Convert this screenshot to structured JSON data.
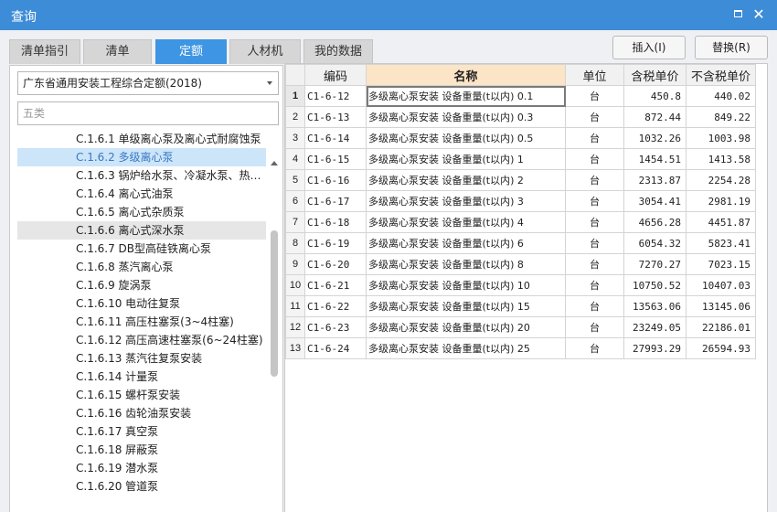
{
  "window": {
    "title": "查询"
  },
  "tabs": [
    {
      "label": "清单指引",
      "active": false
    },
    {
      "label": "清单",
      "active": false
    },
    {
      "label": "定额",
      "active": true
    },
    {
      "label": "人材机",
      "active": false
    },
    {
      "label": "我的数据",
      "active": false
    }
  ],
  "actions": {
    "insert_label": "插入(I)",
    "replace_label": "替换(R)"
  },
  "library": {
    "selected": "广东省通用安装工程综合定额(2018)"
  },
  "search": {
    "value": "五类"
  },
  "tree": {
    "items": [
      {
        "label": "C.1.6.1 单级离心泵及离心式耐腐蚀泵",
        "state": ""
      },
      {
        "label": "C.1.6.2 多级离心泵",
        "state": "selected"
      },
      {
        "label": "C.1.6.3 锅炉给水泵、冷凝水泵、热…",
        "state": ""
      },
      {
        "label": "C.1.6.4 离心式油泵",
        "state": ""
      },
      {
        "label": "C.1.6.5 离心式杂质泵",
        "state": ""
      },
      {
        "label": "C.1.6.6 离心式深水泵",
        "state": "hovered"
      },
      {
        "label": "C.1.6.7 DB型高硅铁离心泵",
        "state": ""
      },
      {
        "label": "C.1.6.8 蒸汽离心泵",
        "state": ""
      },
      {
        "label": "C.1.6.9 旋涡泵",
        "state": ""
      },
      {
        "label": "C.1.6.10 电动往复泵",
        "state": ""
      },
      {
        "label": "C.1.6.11 高压柱塞泵(3~4柱塞)",
        "state": ""
      },
      {
        "label": "C.1.6.12 高压高速柱塞泵(6~24柱塞)",
        "state": ""
      },
      {
        "label": "C.1.6.13 蒸汽往复泵安装",
        "state": ""
      },
      {
        "label": "C.1.6.14 计量泵",
        "state": ""
      },
      {
        "label": "C.1.6.15 螺杆泵安装",
        "state": ""
      },
      {
        "label": "C.1.6.16 齿轮油泵安装",
        "state": ""
      },
      {
        "label": "C.1.6.17 真空泵",
        "state": ""
      },
      {
        "label": "C.1.6.18 屏蔽泵",
        "state": ""
      },
      {
        "label": "C.1.6.19 潜水泵",
        "state": ""
      },
      {
        "label": "C.1.6.20 管道泵",
        "state": ""
      }
    ]
  },
  "grid": {
    "columns": [
      "编码",
      "名称",
      "单位",
      "含税单价",
      "不含税单价"
    ],
    "rows": [
      {
        "n": "1",
        "code": "C1-6-12",
        "name": "多级离心泵安装 设备重量(t以内) 0.1",
        "unit": "台",
        "tax": "450.8",
        "notax": "440.02"
      },
      {
        "n": "2",
        "code": "C1-6-13",
        "name": "多级离心泵安装 设备重量(t以内) 0.3",
        "unit": "台",
        "tax": "872.44",
        "notax": "849.22"
      },
      {
        "n": "3",
        "code": "C1-6-14",
        "name": "多级离心泵安装 设备重量(t以内) 0.5",
        "unit": "台",
        "tax": "1032.26",
        "notax": "1003.98"
      },
      {
        "n": "4",
        "code": "C1-6-15",
        "name": "多级离心泵安装 设备重量(t以内) 1",
        "unit": "台",
        "tax": "1454.51",
        "notax": "1413.58"
      },
      {
        "n": "5",
        "code": "C1-6-16",
        "name": "多级离心泵安装 设备重量(t以内) 2",
        "unit": "台",
        "tax": "2313.87",
        "notax": "2254.28"
      },
      {
        "n": "6",
        "code": "C1-6-17",
        "name": "多级离心泵安装 设备重量(t以内) 3",
        "unit": "台",
        "tax": "3054.41",
        "notax": "2981.19"
      },
      {
        "n": "7",
        "code": "C1-6-18",
        "name": "多级离心泵安装 设备重量(t以内) 4",
        "unit": "台",
        "tax": "4656.28",
        "notax": "4451.87"
      },
      {
        "n": "8",
        "code": "C1-6-19",
        "name": "多级离心泵安装 设备重量(t以内) 6",
        "unit": "台",
        "tax": "6054.32",
        "notax": "5823.41"
      },
      {
        "n": "9",
        "code": "C1-6-20",
        "name": "多级离心泵安装 设备重量(t以内) 8",
        "unit": "台",
        "tax": "7270.27",
        "notax": "7023.15"
      },
      {
        "n": "10",
        "code": "C1-6-21",
        "name": "多级离心泵安装 设备重量(t以内) 10",
        "unit": "台",
        "tax": "10750.52",
        "notax": "10407.03"
      },
      {
        "n": "11",
        "code": "C1-6-22",
        "name": "多级离心泵安装 设备重量(t以内) 15",
        "unit": "台",
        "tax": "13563.06",
        "notax": "13145.06"
      },
      {
        "n": "12",
        "code": "C1-6-23",
        "name": "多级离心泵安装 设备重量(t以内) 20",
        "unit": "台",
        "tax": "23249.05",
        "notax": "22186.01"
      },
      {
        "n": "13",
        "code": "C1-6-24",
        "name": "多级离心泵安装 设备重量(t以内) 25",
        "unit": "台",
        "tax": "27993.29",
        "notax": "26594.93"
      }
    ]
  },
  "colors": {
    "accent": "#3d95e3",
    "titlebar": "#3d8cd7",
    "selected_row": "#cde5f9",
    "header_highlight": "#fce4c6"
  }
}
